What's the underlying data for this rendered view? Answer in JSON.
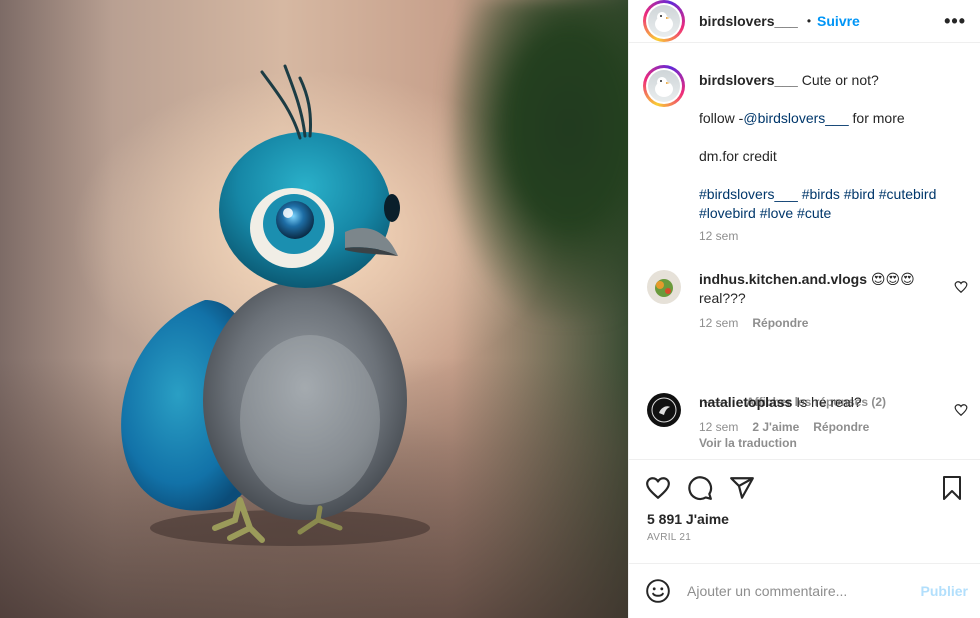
{
  "post": {
    "username": "birdslovers___",
    "separator": "•",
    "follow_label": "Suivre",
    "more_label": "•••"
  },
  "caption": {
    "username": "birdslovers___",
    "text_1": "Cute or not?",
    "follow_prefix": "follow -",
    "follow_mention": "@birdslovers___",
    "follow_suffix": " for more",
    "credit": "dm.for credit",
    "hashtags_line1": "#birdslovers___ #birds #bird #cutebird",
    "hashtags_line2": "#lovebird #love #cute",
    "time": "12 sem"
  },
  "comments": [
    {
      "username": "indhus.kitchen.and.vlogs",
      "text_emoji": "😍😍😍",
      "text": "real???",
      "time": "12 sem",
      "reply_label": "Répondre",
      "view_replies": "Afficher les réponses (2)"
    },
    {
      "username": "natalietoplass",
      "text": "Is he real?",
      "time": "12 sem",
      "likes": "2 J'aime",
      "reply_label": "Répondre",
      "translate": "Voir la traduction"
    }
  ],
  "actions": {
    "like_icon": "heart-icon",
    "comment_icon": "comment-icon",
    "share_icon": "send-icon",
    "save_icon": "bookmark-icon",
    "likes_count": "5 891 J'aime",
    "date": "AVRIL 21"
  },
  "add_comment": {
    "emoji_icon": "smiley-icon",
    "placeholder": "Ajouter un commentaire...",
    "post_label": "Publier"
  },
  "colors": {
    "link": "#00376b",
    "follow": "#0095f6",
    "muted": "#8e8e8e",
    "publish_disabled": "#b2dffc"
  }
}
